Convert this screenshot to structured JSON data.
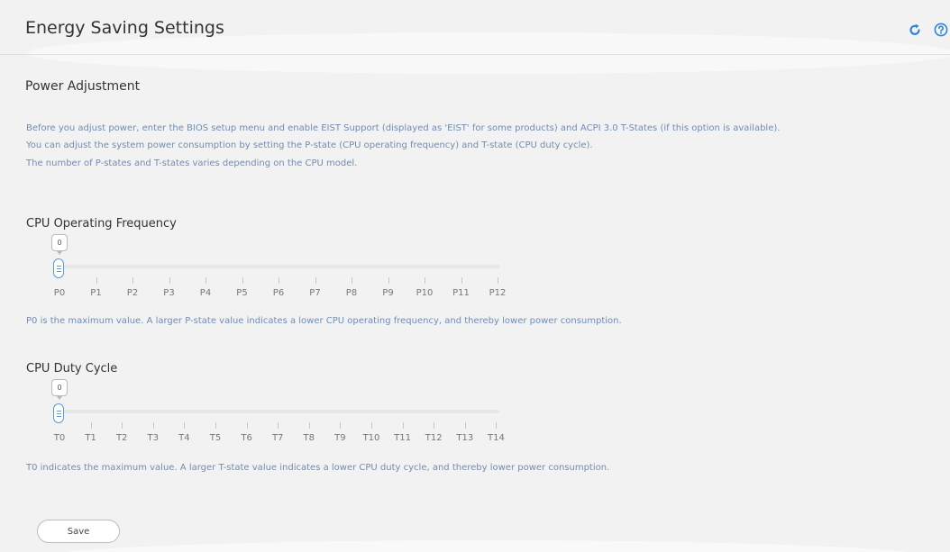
{
  "header": {
    "title": "Energy Saving Settings",
    "refresh_icon": "refresh-icon",
    "help_icon": "help-icon",
    "accent_color": "#2e86d6"
  },
  "section": {
    "title": "Power Adjustment",
    "description": [
      "Before you adjust power, enter the BIOS setup menu and enable EIST Support (displayed as 'EIST' for some products) and ACPI 3.0 T-States (if this option is available).",
      "You can adjust the system power consumption by setting the P-state (CPU operating frequency) and T-state (CPU duty cycle).",
      "The number of P-states and T-states varies depending on the CPU model."
    ]
  },
  "cpu_frequency": {
    "label": "CPU Operating Frequency",
    "value": "0",
    "selected_index": 0,
    "ticks": [
      "P0",
      "P1",
      "P2",
      "P3",
      "P4",
      "P5",
      "P6",
      "P7",
      "P8",
      "P9",
      "P10",
      "P11",
      "P12"
    ],
    "note": "P0 is the maximum value. A larger P-state value indicates a lower CPU operating frequency, and thereby lower power consumption."
  },
  "cpu_duty_cycle": {
    "label": "CPU Duty Cycle",
    "value": "0",
    "selected_index": 0,
    "ticks": [
      "T0",
      "T1",
      "T2",
      "T3",
      "T4",
      "T5",
      "T6",
      "T7",
      "T8",
      "T9",
      "T10",
      "T11",
      "T12",
      "T13",
      "T14"
    ],
    "note": "T0 indicates the maximum value. A larger T-state value indicates a lower CPU duty cycle, and thereby lower power consumption."
  },
  "actions": {
    "save_label": "Save"
  }
}
